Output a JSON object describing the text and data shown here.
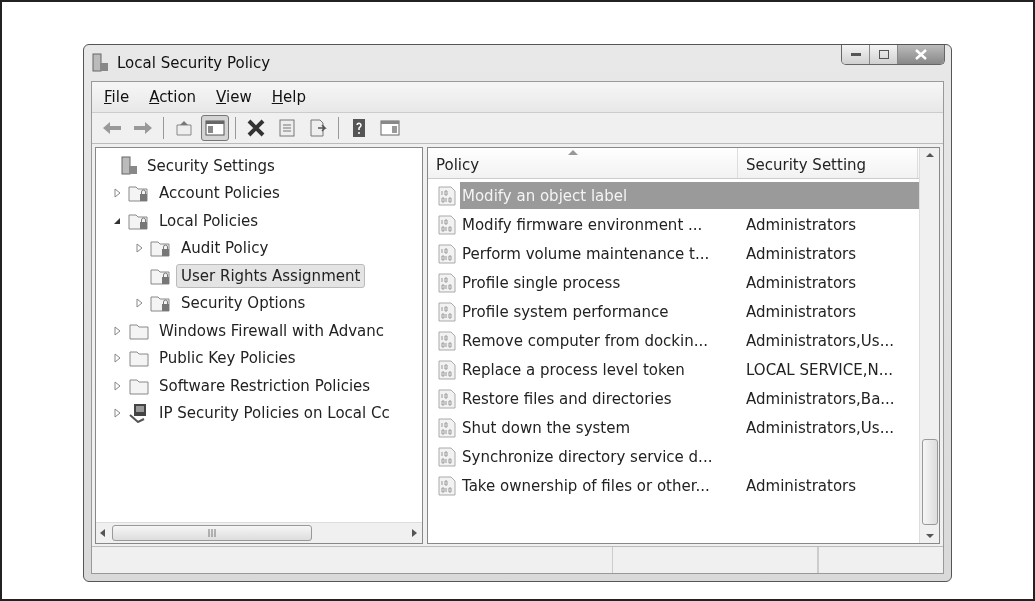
{
  "window": {
    "title": "Local Security Policy"
  },
  "menu": [
    {
      "label": "File"
    },
    {
      "label": "Action"
    },
    {
      "label": "View"
    },
    {
      "label": "Help"
    }
  ],
  "toolbar": [
    {
      "kind": "back",
      "pressed": false
    },
    {
      "kind": "forward",
      "pressed": false
    },
    {
      "kind": "separator"
    },
    {
      "kind": "up",
      "pressed": false
    },
    {
      "kind": "tree",
      "pressed": true
    },
    {
      "kind": "separator"
    },
    {
      "kind": "delete",
      "pressed": false
    },
    {
      "kind": "properties",
      "pressed": false
    },
    {
      "kind": "export",
      "pressed": false
    },
    {
      "kind": "separator"
    },
    {
      "kind": "help",
      "pressed": false
    },
    {
      "kind": "pane",
      "pressed": false
    }
  ],
  "tree": [
    {
      "label": "Security Settings",
      "kind": "root",
      "selected": false,
      "children": [
        {
          "label": "Account Policies",
          "kind": "lock",
          "expanded": false,
          "selected": false
        },
        {
          "label": "Local Policies",
          "kind": "lock",
          "expanded": true,
          "selected": false,
          "children": [
            {
              "label": "Audit Policy",
              "kind": "lock",
              "expanded": false,
              "selected": false
            },
            {
              "label": "User Rights Assignment",
              "kind": "lock",
              "selected": true
            },
            {
              "label": "Security Options",
              "kind": "lock",
              "expanded": false,
              "selected": false
            }
          ]
        },
        {
          "label": "Windows Firewall with Advanc",
          "kind": "folder",
          "expanded": false,
          "selected": false
        },
        {
          "label": "Public Key Policies",
          "kind": "folder",
          "expanded": false,
          "selected": false
        },
        {
          "label": "Software Restriction Policies",
          "kind": "folder",
          "expanded": false,
          "selected": false
        },
        {
          "label": "IP Security Policies on Local Cc",
          "kind": "network",
          "expanded": false,
          "selected": false
        }
      ]
    }
  ],
  "list": {
    "columns": [
      "Policy",
      "Security Setting"
    ],
    "rows": [
      {
        "policy": "Modify an object label",
        "selected": true
      },
      {
        "policy": "Modify firmware environment ...",
        "setting": "Administrators",
        "selected": false
      },
      {
        "policy": "Perform volume maintenance t...",
        "setting": "Administrators",
        "selected": false
      },
      {
        "policy": "Profile single process",
        "setting": "Administrators",
        "selected": false
      },
      {
        "policy": "Profile system performance",
        "setting": "Administrators",
        "selected": false
      },
      {
        "policy": "Remove computer from dockin...",
        "setting": "Administrators,Us...",
        "selected": false
      },
      {
        "policy": "Replace a process level token",
        "setting": "LOCAL SERVICE,N...",
        "selected": false
      },
      {
        "policy": "Restore files and directories",
        "setting": "Administrators,Ba...",
        "selected": false
      },
      {
        "policy": "Shut down the system",
        "setting": "Administrators,Us...",
        "selected": false
      },
      {
        "policy": "Synchronize directory service d...",
        "selected": false
      },
      {
        "policy": "Take ownership of files or other...",
        "setting": "Administrators",
        "selected": false
      }
    ]
  }
}
